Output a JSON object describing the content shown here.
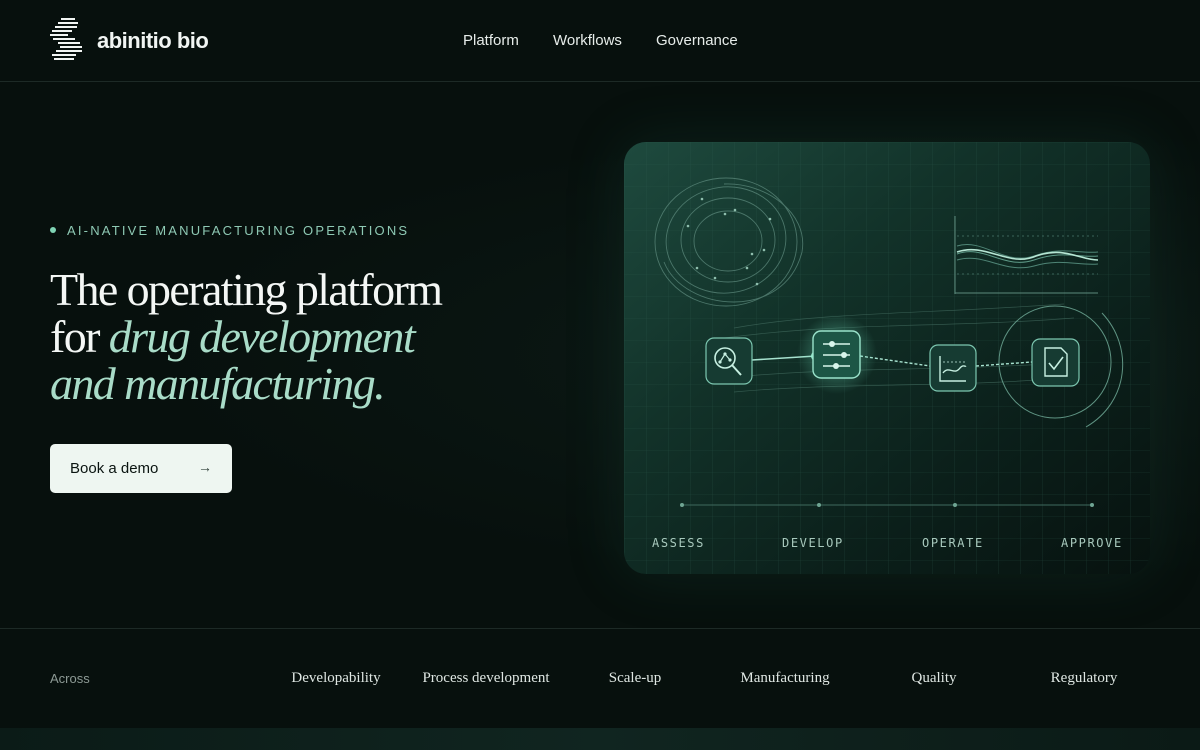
{
  "header": {
    "brand": "abinitio bio",
    "nav": [
      "Platform",
      "Workflows",
      "Governance"
    ]
  },
  "hero": {
    "eyebrow": "AI-NATIVE MANUFACTURING OPERATIONS",
    "headline_plain_1": "The operating platform",
    "headline_plain_2": "for ",
    "headline_em_2": "drug development",
    "headline_em_3": "and manufacturing.",
    "cta_label": "Book a demo",
    "cta_arrow": "→"
  },
  "workflow": {
    "stages": [
      "ASSESS",
      "DEVELOP",
      "OPERATE",
      "APPROVE"
    ],
    "icons": [
      "magnifier-graph-icon",
      "sliders-icon",
      "chart-trend-icon",
      "document-check-icon"
    ]
  },
  "strip": {
    "label": "Across",
    "phases": [
      "Developability",
      "Process development",
      "Scale-up",
      "Manufacturing",
      "Quality",
      "Regulatory"
    ]
  },
  "colors": {
    "accent": "#a9dcc8",
    "background": "#07100d",
    "panel": "#123229"
  }
}
